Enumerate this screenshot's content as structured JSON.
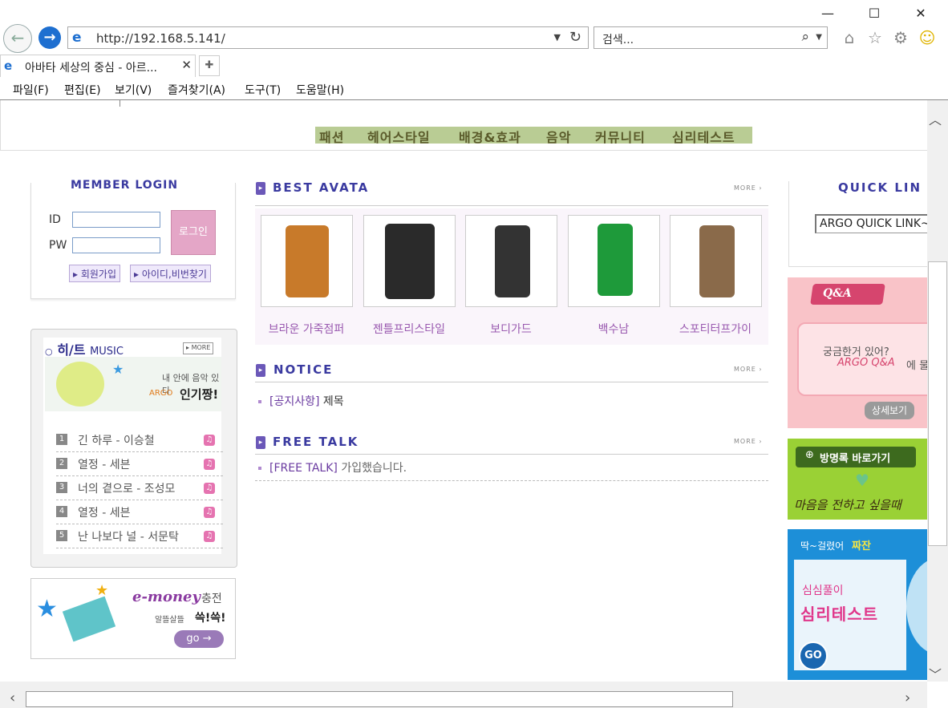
{
  "window": {
    "minimize": "—",
    "maximize": "☐",
    "close": "✕"
  },
  "browser": {
    "url": "http://192.168.5.141/",
    "search_placeholder": "검색...",
    "tab_title": "아바타 세상의 중심 - 아르...",
    "menu": [
      "파일(F)",
      "편집(E)",
      "보기(V)",
      "즐겨찾기(A)",
      "도구(T)",
      "도움말(H)"
    ]
  },
  "site": {
    "nav": [
      "패션",
      "헤어스타일",
      "배경&효과",
      "음악",
      "커뮤니티",
      "심리테스트"
    ],
    "login": {
      "heading": "MEMBER LOGIN",
      "id_label": "ID",
      "pw_label": "PW",
      "login_button": "로그인",
      "join_button": "회원가입",
      "find_button": "아이디,비번찾기"
    },
    "music": {
      "title_bold": "히/트",
      "title_rest": "MUSIC",
      "more": "MORE",
      "banner_line1": "내 안에 음악 있다",
      "banner_brand": "ARGO",
      "banner_line2": "인기짱!",
      "songs": [
        {
          "num": "1",
          "title": "긴 하루 - 이승철"
        },
        {
          "num": "2",
          "title": "열정 - 세븐"
        },
        {
          "num": "3",
          "title": "너의 곁으로 - 조성모"
        },
        {
          "num": "4",
          "title": "열정 - 세븐"
        },
        {
          "num": "5",
          "title": "난 나보다 널 - 서문탁"
        }
      ]
    },
    "emoney": {
      "title": "e-money",
      "title_suffix": "충전",
      "subtitle": "알뜰살뜰",
      "subtitle_bold": "쓱!쓱!",
      "go": "go →"
    },
    "best_avata": {
      "heading": "BEST AVATA",
      "more": "MORE",
      "items": [
        "브라운 가죽점퍼",
        "젠틀프리스타일",
        "보디가드",
        "백수남",
        "스포티터프가이"
      ]
    },
    "notice": {
      "heading": "NOTICE",
      "more": "MORE",
      "items": [
        {
          "tag": "[공지사항]",
          "text": "제목"
        }
      ]
    },
    "free_talk": {
      "heading": "FREE TALK",
      "more": "MORE",
      "items": [
        {
          "tag": "[FREE TALK]",
          "text": "가입했습니다."
        }
      ]
    },
    "quick": {
      "heading": "QUICK LIN",
      "select_value": "ARGO QUICK LINK~"
    },
    "qna": {
      "title": "Q&A",
      "line1": "궁금한거 있어?",
      "line2_brand": "ARGO Q&A",
      "line2_rest": "에 물",
      "detail_button": "상세보기"
    },
    "guestbook": {
      "button": "방명록 바로가기",
      "text": "마음을 전하고 싶을때"
    },
    "psytest": {
      "top": "딱~걸렸어",
      "top_bold": "짜잔",
      "line1": "심심풀이",
      "line2": "심리테스트",
      "go": "GO"
    }
  },
  "colors": {
    "nav_strip": "#b9cc94",
    "heading": "#3a3aa0",
    "avatar_name": "#9a5ab0",
    "qna_bg": "#f9c3c8",
    "guest_bg": "#9ad135",
    "psy_bg": "#1d8fd8"
  }
}
